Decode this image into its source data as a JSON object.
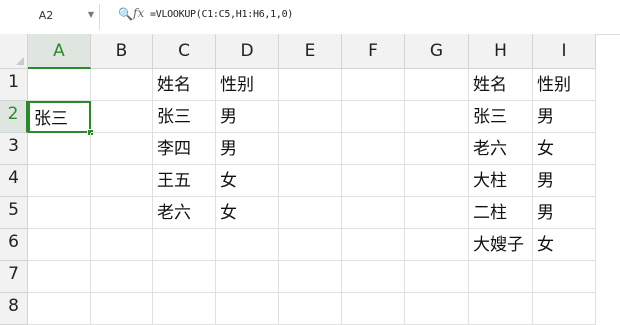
{
  "formula_bar": {
    "name_box": "A2",
    "zoom_icon": "zoom-icon",
    "fx_label": "fx",
    "formula": "=VLOOKUP(C1:C5,H1:H6,1,0)"
  },
  "columns": [
    "A",
    "B",
    "C",
    "D",
    "E",
    "F",
    "G",
    "H",
    "I"
  ],
  "rows": [
    "1",
    "2",
    "3",
    "4",
    "5",
    "6",
    "7",
    "8"
  ],
  "selected": {
    "column": "A",
    "row": "2"
  },
  "cells": {
    "A2": "张三",
    "C1": "姓名",
    "D1": "性别",
    "C2": "张三",
    "D2": "男",
    "C3": "李四",
    "D3": "男",
    "C4": "王五",
    "D4": "女",
    "C5": "老六",
    "D5": "女",
    "H1": "姓名",
    "I1": "性别",
    "H2": "张三",
    "I2": "男",
    "H3": "老六",
    "I3": "女",
    "H4": "大柱",
    "I4": "男",
    "H5": "二柱",
    "I5": "男",
    "H6": "大嫂子",
    "I6": "女"
  },
  "colors": {
    "accent": "#2a8a2a",
    "header_bg": "#f2f2f2",
    "grid_line": "#e0e0e0"
  }
}
